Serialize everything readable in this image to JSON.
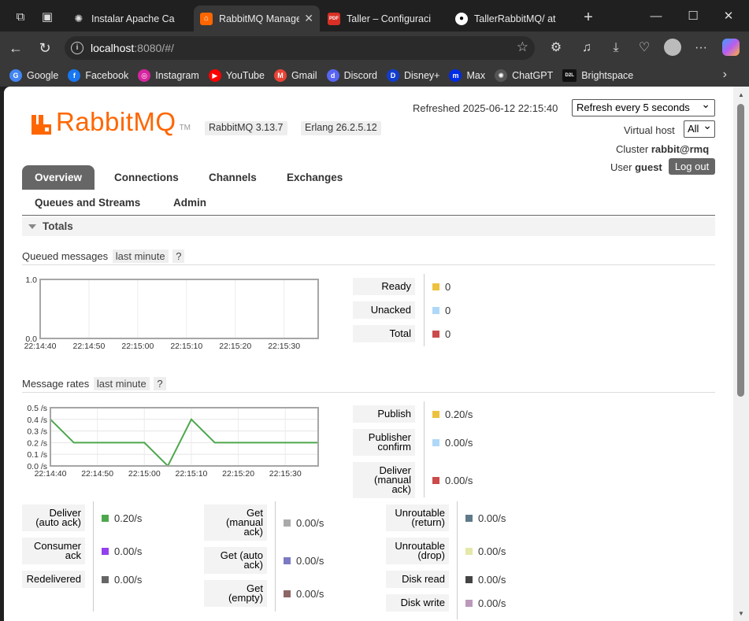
{
  "browser": {
    "tabs": [
      {
        "title": "Instalar Apache Ca",
        "icon": "chatgpt-icon",
        "active": false
      },
      {
        "title": "RabbitMQ Manage",
        "icon": "rabbitmq-icon",
        "active": true
      },
      {
        "title": "Taller – Configuraci",
        "icon": "pdf-icon",
        "active": false
      },
      {
        "title": "TallerRabbitMQ/ at",
        "icon": "github-icon",
        "active": false
      }
    ],
    "url_host": "localhost",
    "url_rest": ":8080/#/",
    "bookmarks": [
      {
        "label": "Google",
        "color": "#4285f4",
        "glyph": "G"
      },
      {
        "label": "Facebook",
        "color": "#1877f2",
        "glyph": "f"
      },
      {
        "label": "Instagram",
        "color": "#d6249f",
        "glyph": "◎"
      },
      {
        "label": "YouTube",
        "color": "#ff0000",
        "glyph": "▶"
      },
      {
        "label": "Gmail",
        "color": "#ea4335",
        "glyph": "M"
      },
      {
        "label": "Discord",
        "color": "#5865f2",
        "glyph": "d"
      },
      {
        "label": "Disney+",
        "color": "#113ccf",
        "glyph": "D"
      },
      {
        "label": "Max",
        "color": "#002be7",
        "glyph": "m"
      },
      {
        "label": "ChatGPT",
        "color": "#555",
        "glyph": "✺"
      },
      {
        "label": "Brightspace",
        "color": "#111",
        "glyph": "D2L"
      }
    ]
  },
  "header": {
    "logo_text": "RabbitMQ",
    "logo_tm": "TM",
    "rabbitmq_version": "RabbitMQ 3.13.7",
    "erlang_version": "Erlang 26.2.5.12",
    "refreshed": "Refreshed 2025-06-12 22:15:40",
    "refresh_option": "Refresh every 5 seconds",
    "vhost_label": "Virtual host",
    "vhost_value": "All",
    "cluster_label": "Cluster",
    "cluster_value": "rabbit@rmq",
    "user_label": "User",
    "user_value": "guest",
    "logout": "Log out"
  },
  "nav": {
    "overview": "Overview",
    "connections": "Connections",
    "channels": "Channels",
    "exchanges": "Exchanges",
    "queues": "Queues and Streams",
    "admin": "Admin"
  },
  "totals": {
    "title": "Totals",
    "queued": {
      "title": "Queued messages",
      "range": "last minute",
      "help": "?",
      "legend": [
        {
          "label": "Ready",
          "color": "#edc240",
          "value": "0"
        },
        {
          "label": "Unacked",
          "color": "#afd8f8",
          "value": "0"
        },
        {
          "label": "Total",
          "color": "#cb4b4b",
          "value": "0"
        }
      ]
    },
    "rates": {
      "title": "Message rates",
      "range": "last minute",
      "help": "?",
      "legend": [
        {
          "label": "Publish",
          "color": "#edc240",
          "value": "0.20/s"
        },
        {
          "label": "Publisher confirm",
          "lines": [
            "Publisher",
            "confirm"
          ],
          "color": "#afd8f8",
          "value": "0.00/s"
        },
        {
          "label": "Deliver (manual ack)",
          "lines": [
            "Deliver",
            "(manual",
            "ack)"
          ],
          "color": "#cb4b4b",
          "value": "0.00/s"
        }
      ],
      "col1": [
        {
          "label": "Deliver (auto ack)",
          "lines": [
            "Deliver",
            "(auto ack)"
          ],
          "color": "#4da74d",
          "value": "0.20/s"
        },
        {
          "label": "Consumer ack",
          "lines": [
            "Consumer",
            "ack"
          ],
          "color": "#9440ed",
          "value": "0.00/s"
        },
        {
          "label": "Redelivered",
          "lines": [
            "Redelivered"
          ],
          "color": "#666666",
          "value": "0.00/s"
        }
      ],
      "col2": [
        {
          "label": "Get (manual ack)",
          "lines": [
            "Get",
            "(manual",
            "ack)"
          ],
          "color": "#aaaaaa",
          "value": "0.00/s"
        },
        {
          "label": "Get (auto ack)",
          "lines": [
            "Get (auto",
            "ack)"
          ],
          "color": "#7c79c3",
          "value": "0.00/s"
        },
        {
          "label": "Get (empty)",
          "lines": [
            "Get",
            "(empty)"
          ],
          "color": "#8d6767",
          "value": "0.00/s"
        }
      ],
      "col3": [
        {
          "label": "Unroutable (return)",
          "lines": [
            "Unroutable",
            "(return)"
          ],
          "color": "#5f7a89",
          "value": "0.00/s"
        },
        {
          "label": "Unroutable (drop)",
          "lines": [
            "Unroutable",
            "(drop)"
          ],
          "color": "#e5e8a8",
          "value": "0.00/s"
        },
        {
          "label": "Disk read",
          "lines": [
            "Disk read"
          ],
          "color": "#444444",
          "value": "0.00/s"
        },
        {
          "label": "Disk write",
          "lines": [
            "Disk write"
          ],
          "color": "#bb99bb",
          "value": "0.00/s"
        }
      ]
    }
  },
  "chart_data": [
    {
      "type": "line",
      "x": [
        "22:14:40",
        "22:14:50",
        "22:15:00",
        "22:15:10",
        "22:15:20",
        "22:15:30"
      ],
      "ylim": [
        0,
        1.0
      ],
      "yticks": [
        "1.0",
        "0.0"
      ],
      "series": [
        {
          "name": "Ready",
          "color": "#edc240",
          "values": [
            0,
            0,
            0,
            0,
            0,
            0,
            0
          ]
        },
        {
          "name": "Unacked",
          "color": "#afd8f8",
          "values": [
            0,
            0,
            0,
            0,
            0,
            0,
            0
          ]
        },
        {
          "name": "Total",
          "color": "#cb4b4b",
          "values": [
            0,
            0,
            0,
            0,
            0,
            0,
            0
          ]
        }
      ],
      "grid": true
    },
    {
      "type": "line",
      "x": [
        "22:14:40",
        "22:14:50",
        "22:15:00",
        "22:15:10",
        "22:15:20",
        "22:15:30"
      ],
      "ylim": [
        0,
        0.5
      ],
      "yticks": [
        "0.5 /s",
        "0.4 /s",
        "0.3 /s",
        "0.2 /s",
        "0.1 /s",
        "0.0 /s"
      ],
      "series": [
        {
          "name": "Deliver (auto ack)",
          "color": "#4da74d",
          "points": [
            [
              0,
              0.4
            ],
            [
              5,
              0.2
            ],
            [
              20,
              0.2
            ],
            [
              25,
              0.0
            ],
            [
              30,
              0.4
            ],
            [
              35,
              0.2
            ],
            [
              57,
              0.2
            ]
          ]
        },
        {
          "name": "Consumer ack",
          "color": "#9440ed",
          "points": [
            [
              0,
              0
            ],
            [
              57,
              0
            ]
          ]
        }
      ],
      "x_span_seconds": 57,
      "grid": true
    }
  ]
}
